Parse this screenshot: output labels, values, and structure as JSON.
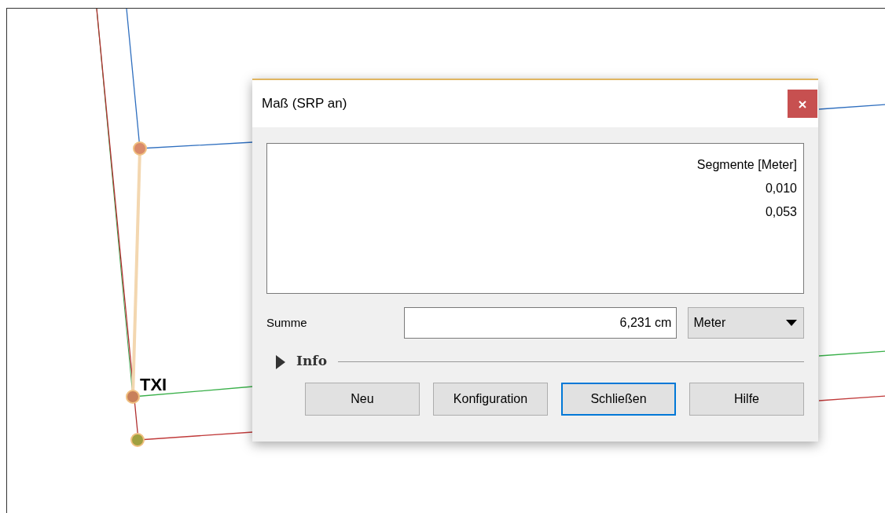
{
  "map": {
    "labels": [
      "TXI"
    ]
  },
  "dialog": {
    "title": "Maß (SRP an)",
    "segments": {
      "header": "Segmente [Meter]",
      "values": [
        "0,010",
        "0,053"
      ]
    },
    "sum": {
      "label": "Summe",
      "value": "6,231 cm",
      "unit": "Meter"
    },
    "info": {
      "label": "Info",
      "expanded": false
    },
    "buttons": [
      {
        "label": "Neu",
        "default": false
      },
      {
        "label": "Konfiguration",
        "default": false
      },
      {
        "label": "Schließen",
        "default": true
      },
      {
        "label": "Hilfe",
        "default": false
      }
    ]
  }
}
